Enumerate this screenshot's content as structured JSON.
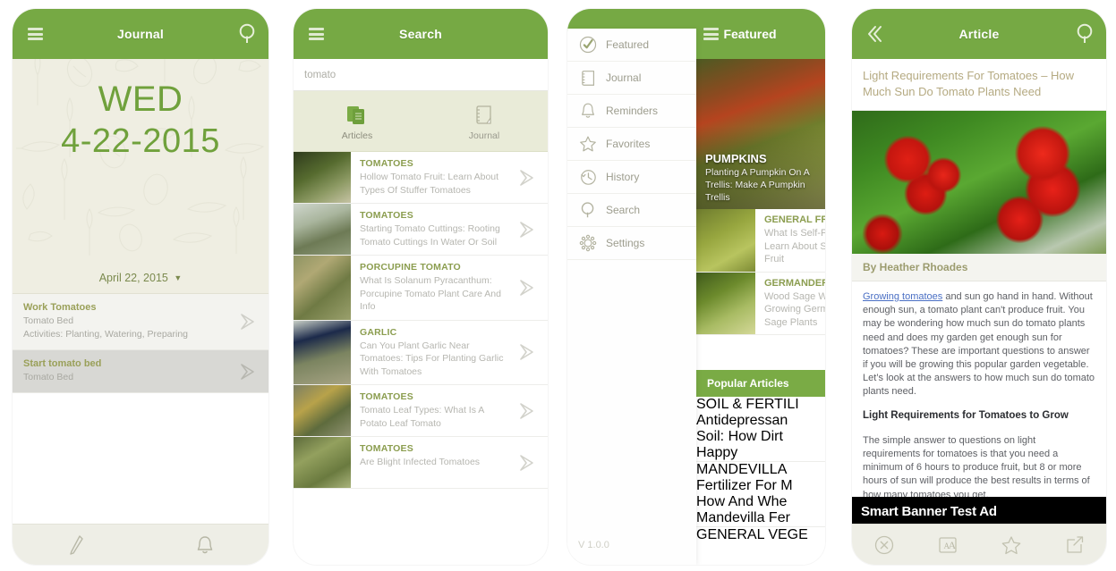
{
  "colors": {
    "brand_green": "#76a944",
    "accent_green": "#70a13c",
    "category_green": "#8b9d4f",
    "muted_text": "#b6b6b0",
    "link_blue": "#4a6fc4"
  },
  "journal_screen": {
    "navbar": {
      "title": "Journal",
      "menu_icon": "hamburger-icon",
      "search_icon": "search-icon"
    },
    "hero": {
      "day_of_week": "WED",
      "date_numeric": "4-22-2015"
    },
    "date_selector": {
      "label": "April 22, 2015",
      "caret": "▼"
    },
    "entries": [
      {
        "title": "Work Tomatoes",
        "bed": "Tomato Bed",
        "activities": "Activities: Planting, Watering, Preparing",
        "selected": false
      },
      {
        "title": "Start tomato bed",
        "bed": "Tomato Bed",
        "activities": "",
        "selected": true
      }
    ],
    "bottom_bar": [
      {
        "icon": "pencil-icon",
        "name": "new-entry-button"
      },
      {
        "icon": "bell-icon",
        "name": "reminders-button"
      }
    ]
  },
  "search_screen": {
    "navbar": {
      "title": "Search",
      "menu_icon": "hamburger-icon"
    },
    "search_input": {
      "value": "tomato",
      "placeholder": "Search"
    },
    "tabs": [
      {
        "label": "Articles",
        "icon": "articles-icon",
        "active": true
      },
      {
        "label": "Journal",
        "icon": "journal-icon",
        "active": false
      }
    ],
    "results": [
      {
        "category": "TOMATOES",
        "title": "Hollow Tomato Fruit: Learn About Types Of Stuffer Tomatoes",
        "thumb": "hands-planting"
      },
      {
        "category": "TOMATOES",
        "title": "Starting Tomato Cuttings: Rooting Tomato Cuttings In Water Or Soil",
        "thumb": "jar-cuttings"
      },
      {
        "category": "PORCUPINE TOMATO",
        "title": "What Is Solanum Pyracanthum: Porcupine Tomato Plant Care And Info",
        "thumb": "porcupine-plant"
      },
      {
        "category": "GARLIC",
        "title": "Can You Plant Garlic Near Tomatoes: Tips For Planting Garlic With Tomatoes",
        "thumb": "garlic-field"
      },
      {
        "category": "TOMATOES",
        "title": "Tomato Leaf Types: What Is A Potato Leaf Tomato",
        "thumb": "yellow-tomato"
      },
      {
        "category": "TOMATOES",
        "title": "Are Blight Infected Tomatoes",
        "thumb": "blight-tomato"
      }
    ]
  },
  "menu_screen": {
    "navbar": {
      "title": "Featured",
      "menu_icon": "hamburger-icon"
    },
    "drawer": {
      "items": [
        {
          "label": "Featured",
          "icon": "check-circle-icon"
        },
        {
          "label": "Journal",
          "icon": "notebook-icon"
        },
        {
          "label": "Reminders",
          "icon": "bell-icon"
        },
        {
          "label": "Favorites",
          "icon": "star-icon"
        },
        {
          "label": "History",
          "icon": "clock-icon"
        },
        {
          "label": "Search",
          "icon": "search-icon"
        },
        {
          "label": "Settings",
          "icon": "gear-icon"
        }
      ],
      "version": "V 1.0.0"
    },
    "featured_hero": {
      "category": "PUMPKINS",
      "title": "Planting A Pumpkin On A Trellis: Make A Pumpkin Trellis"
    },
    "featured_list": [
      {
        "category": "GENERAL FRUIT",
        "lines": [
          "What Is Self-Fru",
          "Learn About Se",
          "Fruit"
        ]
      },
      {
        "category": "GERMANDER",
        "lines": [
          "Wood Sage W",
          "Growing Germ",
          "Sage Plants"
        ]
      }
    ],
    "popular": {
      "header": "Popular Articles",
      "items": [
        {
          "category": "SOIL & FERTILI",
          "lines": [
            "Antidepressan",
            "Soil: How Dirt",
            "Happy"
          ]
        },
        {
          "category": "MANDEVILLA",
          "lines": [
            "Fertilizer For M",
            "How And Whe",
            "Mandevilla Fer"
          ]
        },
        {
          "category": "GENERAL VEGE",
          "lines": []
        }
      ]
    }
  },
  "article_screen": {
    "navbar": {
      "title": "Article",
      "back_icon": "back-chevron-icon",
      "search_icon": "search-icon"
    },
    "title": "Light Requirements For Tomatoes – How Much Sun Do Tomato Plants Need",
    "byline": "By Heather Rhoades",
    "link_text": "Growing tomatoes",
    "paragraph_1": " and sun go hand in hand. Without enough sun, a tomato plant can't produce fruit. You may be wondering how much sun do tomato plants need and does my garden get enough sun for tomatoes? These are important questions to answer if you will be growing this popular garden vegetable. Let’s look at the answers to how much sun do tomato plants need.",
    "heading_2": "Light Requirements for Tomatoes to Grow",
    "paragraph_2": "The simple answer to questions on light requirements for tomatoes is that you need a minimum of 6 hours to produce fruit, but 8 or more hours of sun will produce the best results in terms of how many tomatoes you get.",
    "ad_text": "Smart Banner Test Ad",
    "bottom_bar": [
      {
        "icon": "close-circle-icon",
        "name": "close-button"
      },
      {
        "icon": "text-size-icon",
        "name": "font-size-button"
      },
      {
        "icon": "star-icon",
        "name": "favorite-button"
      },
      {
        "icon": "share-icon",
        "name": "share-button"
      }
    ]
  }
}
